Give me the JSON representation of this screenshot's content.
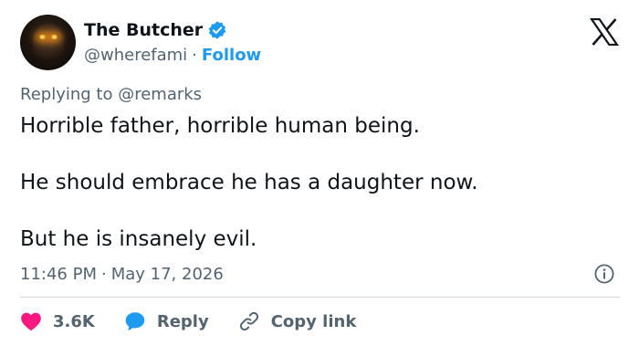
{
  "user": {
    "display_name": "The Butcher",
    "handle": "@wherefami",
    "follow_label": "Follow",
    "separator": "·"
  },
  "reply": {
    "prefix": "Replying to",
    "target": "@remarks"
  },
  "tweet": {
    "lines": [
      "Horrible father, horrible human being.",
      "He should embrace he has a daughter now.",
      "But he is insanely evil."
    ],
    "time": "11:46 PM",
    "date": "May 17, 2026",
    "separator": "·"
  },
  "actions": {
    "like_count": "3.6K",
    "reply_label": "Reply",
    "copy_label": "Copy link"
  },
  "colors": {
    "accent": "#1d9bf0",
    "like": "#f91880",
    "secondary_text": "#536471",
    "primary_text": "#0f1419",
    "divider": "#cfd9de"
  },
  "icons": {
    "verified": "verified-badge-icon",
    "brand": "x-logo-icon",
    "info": "info-icon",
    "like": "heart-icon",
    "reply": "speech-bubble-icon",
    "copy": "link-icon"
  }
}
